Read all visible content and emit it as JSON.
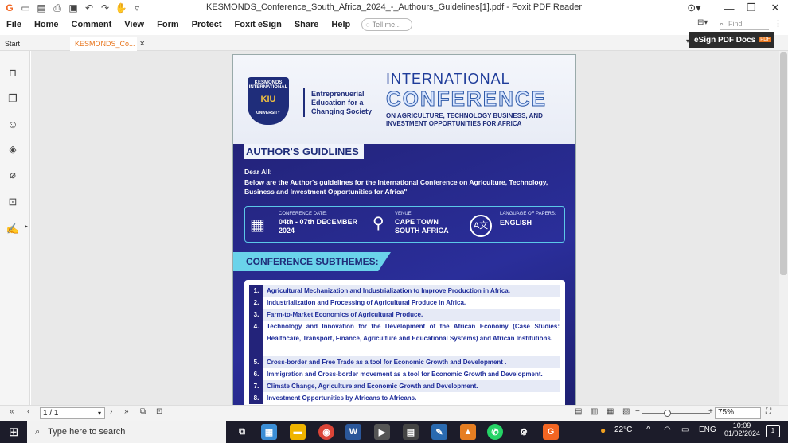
{
  "window": {
    "title": "KESMONDS_Conference_South_Africa_2024_-_Authours_Guidelines[1].pdf - Foxit PDF Reader"
  },
  "menu": [
    "File",
    "Home",
    "Comment",
    "View",
    "Form",
    "Protect",
    "Foxit eSign",
    "Share",
    "Help"
  ],
  "tell_me": "Tell me...",
  "find": "Find",
  "tabs": {
    "start": "Start",
    "doc": "KESMONDS_Co...",
    "close": "×"
  },
  "esign": {
    "label": "eSign PDF Docs",
    "badge": "PDF"
  },
  "doc": {
    "logo_text": "KESMONDS INTERNATIONAL",
    "logo_kiu": "KIU",
    "logo_university": "UNIVERSITY",
    "tagline": [
      "Entreprenuerial",
      "Education for a",
      "Changing Society"
    ],
    "intl": "INTERNATIONAL",
    "conference": "CONFERENCE",
    "subtitle": "ON AGRICULTURE, TECHNOLOGY BUSINESS, AND INVESTMENT OPPORTUNITIES FOR AFRICA",
    "guidelines_heading": "AUTHOR'S GUIDLINES",
    "dear": "Dear All:",
    "intro": "Below are the Author's guidelines for the International Conference on Agriculture, Technology, Business and Investment Opportunities for Africa\"",
    "info": {
      "date_label": "CONFERENCE DATE:",
      "date_value_1": "04th - 07th DECEMBER",
      "date_value_2": "2024",
      "venue_label": "VENUE:",
      "venue_value_1": "CAPE TOWN",
      "venue_value_2": "SOUTH AFRICA",
      "lang_label": "LANGUAGE OF PAPERS:",
      "lang_value": "ENGLISH"
    },
    "subthemes_heading": "CONFERENCE SUBTHEMES:",
    "subthemes": [
      {
        "n": "1.",
        "t": "Agricultural Mechanization and Industrialization to Improve Production in Africa."
      },
      {
        "n": "2.",
        "t": "Industrialization and Processing of Agricultural Produce in Africa."
      },
      {
        "n": "3.",
        "t": "Farm-to-Market Economics of Agricultural Produce."
      },
      {
        "n": "4.",
        "t": "Technology and Innovation for the Development of the African Economy (Case Studies: Healthcare, Transport, Finance, Agriculture and Educational Systems) and African Institutions."
      },
      {
        "n": "5.",
        "t": "Cross-border and Free Trade as a tool for Economic Growth and Development ."
      },
      {
        "n": "6.",
        "t": "Immigration and Cross-border movement as a tool for Economic Growth and  Development."
      },
      {
        "n": "7.",
        "t": "Climate Change, Agriculture and Economic Growth and Development."
      },
      {
        "n": "8.",
        "t": "Investment Opportunities by Africans to Africans."
      }
    ]
  },
  "status": {
    "page": "1 / 1",
    "zoom": "75%",
    "zoom_minus": "−",
    "zoom_plus": "+"
  },
  "taskbar": {
    "search_placeholder": "Type here to search",
    "weather": "22°C",
    "lang": "ENG",
    "time": "10:09",
    "date": "01/02/2024",
    "notif": "1"
  }
}
